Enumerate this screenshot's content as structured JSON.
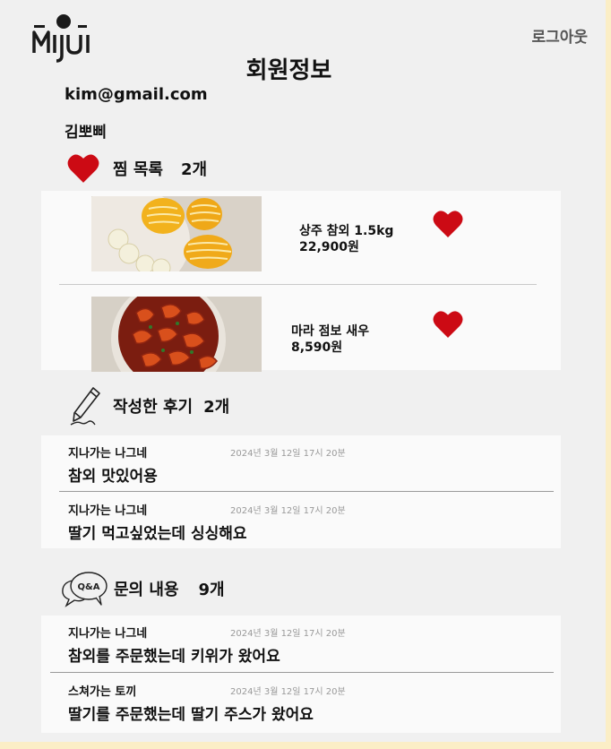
{
  "header": {
    "logo_text": "Mijui",
    "logout_label": "로그아웃"
  },
  "page_title": "회원정보",
  "user": {
    "email": "kim@gmail.com",
    "name": "김뽀삐"
  },
  "wishlist": {
    "title": "찜 목록",
    "count": "2개",
    "items": [
      {
        "name": "상주 참외 1.5kg",
        "price": "22,900원"
      },
      {
        "name": "마라 점보 새우",
        "price": "8,590원"
      }
    ]
  },
  "reviews": {
    "title": "작성한 후기",
    "count": "2개",
    "items": [
      {
        "author": "지나가는 나그네",
        "date": "2024년 3월 12일 17시 20분",
        "body": "참외 맛있어용"
      },
      {
        "author": "지나가는 나그네",
        "date": "2024년 3월 12일 17시 20분",
        "body": "딸기 먹고싶었는데 싱싱해요"
      }
    ]
  },
  "inquiries": {
    "title": "문의 내용",
    "count": "9개",
    "qa_badge": "Q&A",
    "items": [
      {
        "author": "지나가는 나그네",
        "date": "2024년 3월 12일 17시 20분",
        "body": "참외를 주문했는데 키위가 왔어요"
      },
      {
        "author": "스쳐가는 토끼",
        "date": "2024년 3월 12일 17시 20분",
        "body": "딸기를 주문했는데 딸기 주스가 왔어요"
      }
    ]
  },
  "colors": {
    "heart": "#cc0a14",
    "page_bg": "#f0f0f0",
    "panel_bg": "#fafafa",
    "outer_bg": "#fbeec6"
  }
}
